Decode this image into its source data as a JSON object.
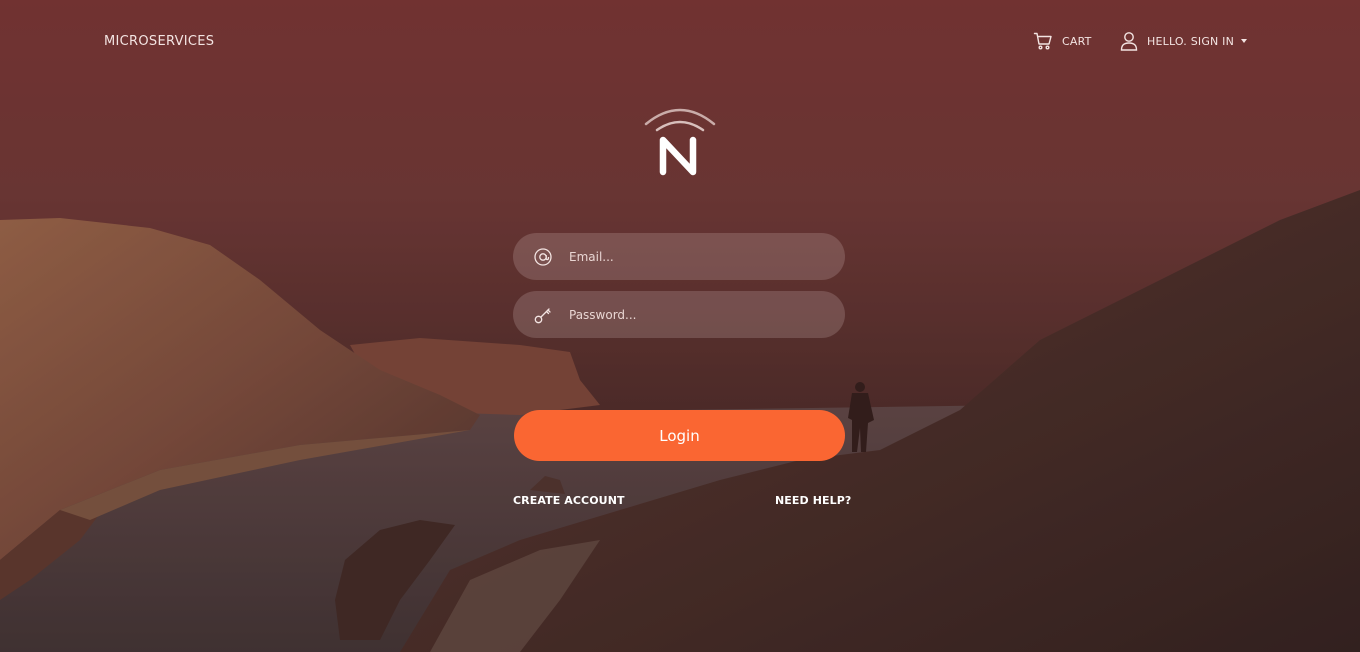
{
  "header": {
    "brand": "MICROSERVICES",
    "cart_label": "CART",
    "user_label": "HELLO. SIGN IN"
  },
  "logo": {
    "letter": "N"
  },
  "form": {
    "email_placeholder": "Email...",
    "password_placeholder": "Password...",
    "login_label": "Login",
    "create_account_label": "CREATE ACCOUNT",
    "need_help_label": "NEED HELP?"
  },
  "colors": {
    "accent": "#fa6632",
    "background_top": "#773636",
    "background_bottom": "#2b2322"
  },
  "icons": {
    "cart": "cart-icon",
    "user": "user-icon",
    "email": "at-icon",
    "password": "key-icon",
    "dropdown": "caret-down-icon"
  }
}
